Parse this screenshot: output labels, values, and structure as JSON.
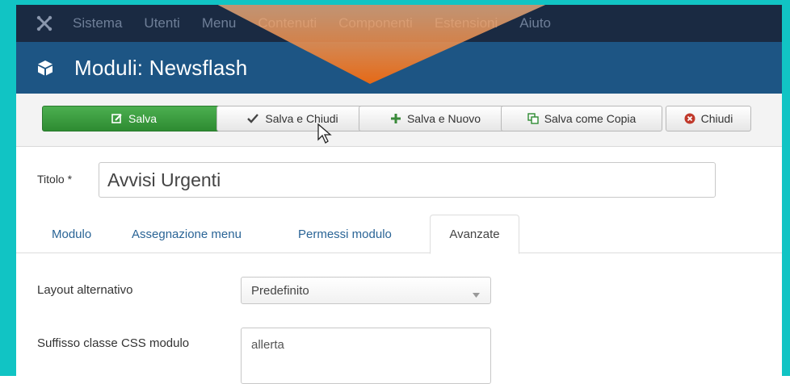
{
  "menubar": {
    "items": [
      "Sistema",
      "Utenti",
      "Menu",
      "Contenuti",
      "Componenti",
      "Estensioni",
      "Aiuto"
    ]
  },
  "header": {
    "title": "Moduli: Newsflash"
  },
  "toolbar": {
    "save": "Salva",
    "save_close": "Salva e Chiudi",
    "save_new": "Salva e Nuovo",
    "save_copy": "Salva come Copia",
    "close": "Chiudi"
  },
  "form": {
    "title_label": "Titolo *",
    "title_value": "Avvisi Urgenti",
    "tabs": [
      "Modulo",
      "Assegnazione menu",
      "Permessi modulo",
      "Avanzate"
    ],
    "active_tab": "Avanzate",
    "layout_label": "Layout alternativo",
    "layout_value": "Predefinito",
    "css_suffix_label": "Suffisso classe CSS modulo",
    "css_suffix_value": "allerta"
  },
  "colors": {
    "frame": "#11c4c4",
    "menubar": "#1a2a42",
    "titlebar": "#1d5584",
    "save_button": "#2e8b32",
    "overlay": "#f07a1a"
  }
}
